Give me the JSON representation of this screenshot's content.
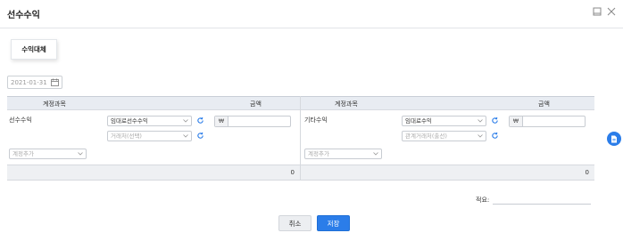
{
  "dialog": {
    "title": "선수수익"
  },
  "tabs": [
    {
      "label": "수익대체"
    }
  ],
  "date": {
    "value": "2021-01-31"
  },
  "left": {
    "headers": {
      "account": "계정과목",
      "amount": "금액"
    },
    "row_label": "선수수익",
    "select1": "임대료선수수익",
    "select2": "거래처(선택)",
    "currency": "₩",
    "amount_value": "",
    "add_account": "계정추가",
    "total": "0"
  },
  "right": {
    "headers": {
      "account": "계정과목",
      "amount": "금액"
    },
    "row_label": "기타수익",
    "select1": "임대료수익",
    "select2": "관계거래처(출선)",
    "currency": "₩",
    "amount_value": "",
    "add_account": "계정추가",
    "total": "0"
  },
  "memo": {
    "label": "적요:",
    "value": ""
  },
  "buttons": {
    "cancel": "취소",
    "save": "저장"
  },
  "icons": {
    "minimize": "window-minimize-icon",
    "close": "close-icon",
    "calendar": "calendar-icon",
    "refresh": "refresh-icon",
    "fab": "document-icon"
  },
  "colors": {
    "accent": "#2b7de9",
    "header_bg": "#e8ecf2"
  }
}
